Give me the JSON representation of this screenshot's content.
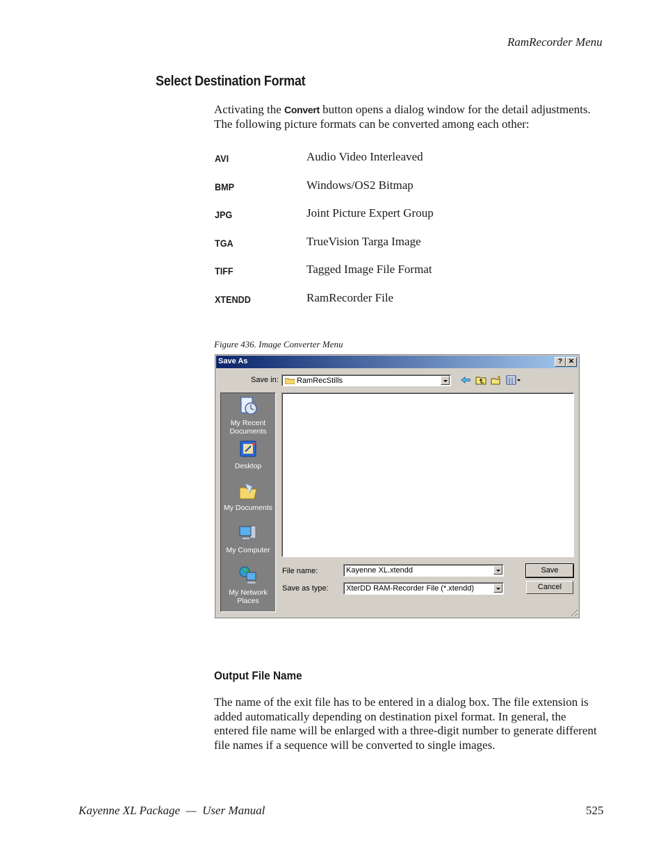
{
  "header": {
    "running_head": "RamRecorder Menu"
  },
  "section": {
    "title": "Select Destination Format",
    "intro_before": "Activating the ",
    "intro_keyword": "Convert",
    "intro_after": " button opens a dialog window for the detail adjust­ments. The following picture formats can be converted among each other:"
  },
  "formats": [
    {
      "code": "AVI",
      "description": "Audio Video Interleaved"
    },
    {
      "code": "BMP",
      "description": "Windows/OS2 Bitmap"
    },
    {
      "code": "JPG",
      "description": "Joint Picture Expert Group"
    },
    {
      "code": "TGA",
      "description": "TrueVision Targa Image"
    },
    {
      "code": "TIFF",
      "description": "Tagged Image File Format"
    },
    {
      "code": "XTENDD",
      "description": "RamRecorder File"
    }
  ],
  "figure": {
    "caption": "Figure 436.  Image Converter Menu"
  },
  "dialog": {
    "title": "Save As",
    "help_label": "?",
    "close_label": "✕",
    "save_in_label": "Save in:",
    "save_in_value": "RamRecStills",
    "toolbar_icons": [
      "back-arrow-icon",
      "up-folder-icon",
      "new-folder-icon",
      "view-menu-icon"
    ],
    "places": [
      {
        "label": "My Recent Documents",
        "icon": "recent-documents-icon"
      },
      {
        "label": "Desktop",
        "icon": "desktop-icon"
      },
      {
        "label": "My Documents",
        "icon": "my-documents-icon"
      },
      {
        "label": "My Computer",
        "icon": "my-computer-icon"
      },
      {
        "label": "My Network Places",
        "icon": "network-places-icon"
      }
    ],
    "file_name_label": "File name:",
    "file_name_value": "Kayenne XL.xtendd",
    "save_as_type_label": "Save as type:",
    "save_as_type_value": "XterDD RAM-Recorder File (*.xtendd)",
    "save_button": "Save",
    "cancel_button": "Cancel"
  },
  "output_section": {
    "title": "Output File Name",
    "body": "The name of the exit file has to be entered in a dialog box. The file extension is added automatically depending on destination pixel format. In general, the entered file name will be enlarged with a three-digit number to gen­erate different file names if a sequence will be converted to single images."
  },
  "footer": {
    "left": "Kayenne XL Package  —  User Manual",
    "page_number": "525"
  }
}
